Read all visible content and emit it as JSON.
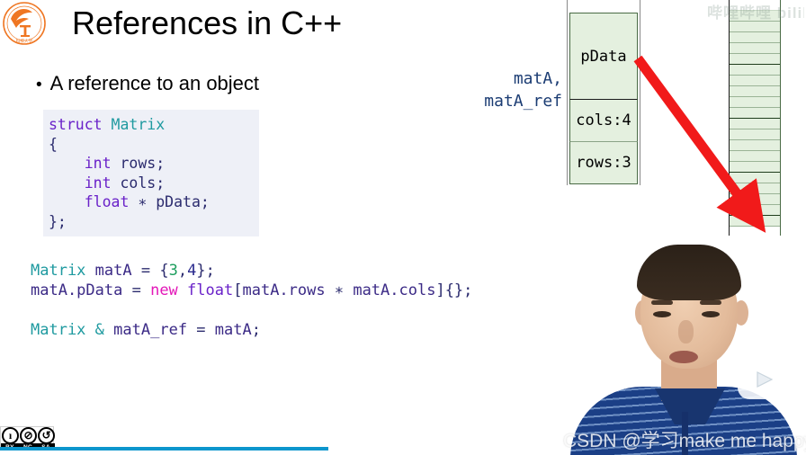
{
  "slide": {
    "title": "References in C++",
    "bullet": "A reference to an object",
    "bullet_marker": "•",
    "logo_name": "university-logo"
  },
  "struct_code": {
    "lines": [
      {
        "parts": [
          {
            "t": "struct ",
            "c": "kw"
          },
          {
            "t": "Matrix",
            "c": "type-id"
          }
        ]
      },
      {
        "parts": [
          {
            "t": "{",
            "c": "punc"
          }
        ]
      },
      {
        "parts": [
          {
            "t": "    ",
            "c": "plain"
          },
          {
            "t": "int",
            "c": "kw"
          },
          {
            "t": " rows;",
            "c": "plain"
          }
        ]
      },
      {
        "parts": [
          {
            "t": "    ",
            "c": "plain"
          },
          {
            "t": "int",
            "c": "kw"
          },
          {
            "t": " cols;",
            "c": "plain"
          }
        ]
      },
      {
        "parts": [
          {
            "t": "    ",
            "c": "plain"
          },
          {
            "t": "float",
            "c": "kw"
          },
          {
            "t": " ∗ pData;",
            "c": "plain"
          }
        ]
      },
      {
        "parts": [
          {
            "t": "};",
            "c": "punc"
          }
        ]
      }
    ]
  },
  "main_code": {
    "lines": [
      {
        "parts": [
          {
            "t": "Matrix",
            "c": "c-type"
          },
          {
            "t": " ",
            "c": ""
          },
          {
            "t": "matA",
            "c": "c-var"
          },
          {
            "t": " = {",
            "c": ""
          },
          {
            "t": "3",
            "c": "c-num3"
          },
          {
            "t": ",",
            "c": ""
          },
          {
            "t": "4",
            "c": "c-num4"
          },
          {
            "t": "};",
            "c": ""
          }
        ]
      },
      {
        "parts": [
          {
            "t": "matA.pData",
            "c": "c-var"
          },
          {
            "t": " = ",
            "c": ""
          },
          {
            "t": "new",
            "c": "c-new"
          },
          {
            "t": " ",
            "c": ""
          },
          {
            "t": "float",
            "c": "c-float"
          },
          {
            "t": "[",
            "c": ""
          },
          {
            "t": "matA.rows",
            "c": "c-var"
          },
          {
            "t": " ∗ ",
            "c": ""
          },
          {
            "t": "matA.cols",
            "c": "c-var"
          },
          {
            "t": "]{};",
            "c": ""
          }
        ]
      },
      {
        "parts": [
          {
            "t": " ",
            "c": ""
          }
        ]
      },
      {
        "parts": [
          {
            "t": "Matrix",
            "c": "c-type"
          },
          {
            "t": " ",
            "c": ""
          },
          {
            "t": "&",
            "c": "c-amp"
          },
          {
            "t": " ",
            "c": ""
          },
          {
            "t": "matA_ref",
            "c": "c-var"
          },
          {
            "t": " = ",
            "c": ""
          },
          {
            "t": "matA",
            "c": "c-var"
          },
          {
            "t": ";",
            "c": ""
          }
        ]
      }
    ]
  },
  "diagram": {
    "variable_label_line1": "matA,",
    "variable_label_line2": "matA_ref",
    "stack_cells": [
      {
        "label": "pData",
        "size": "first"
      },
      {
        "label": "cols:4",
        "size": "mid"
      },
      {
        "label": "rows:3",
        "size": "last"
      }
    ],
    "heap": {
      "row_count": 21,
      "separator_rows": [
        0,
        5,
        10,
        15,
        19
      ],
      "blank_rows": [
        0
      ]
    },
    "arrow_color": "#f11a1a",
    "cell_fill": "#e4f0df",
    "cell_border": "#4a6b46"
  },
  "overlays": {
    "bilibili_top_watermark": "哔哩哔哩 bilibili",
    "csdn_watermark": "CSDN @学习make me happy",
    "play_button_name": "bilibili-play-button",
    "cc_license": {
      "icons": [
        "ı",
        "⊘",
        "↺"
      ],
      "labels": [
        "BY",
        "NC",
        "SA"
      ]
    },
    "progress_color": "#0d96cd"
  }
}
